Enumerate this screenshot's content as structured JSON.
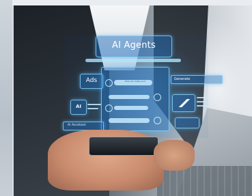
{
  "hologram": {
    "title": "AI Agents",
    "ads_label": "Ads",
    "chip_label": "AI",
    "assistant_label": "AI Assistant",
    "generate_label": "Generate",
    "chat_prompt": "How can I help you?"
  },
  "colors": {
    "hologram_blue": "#3ca8ff",
    "suit_dark": "#1c2127"
  }
}
